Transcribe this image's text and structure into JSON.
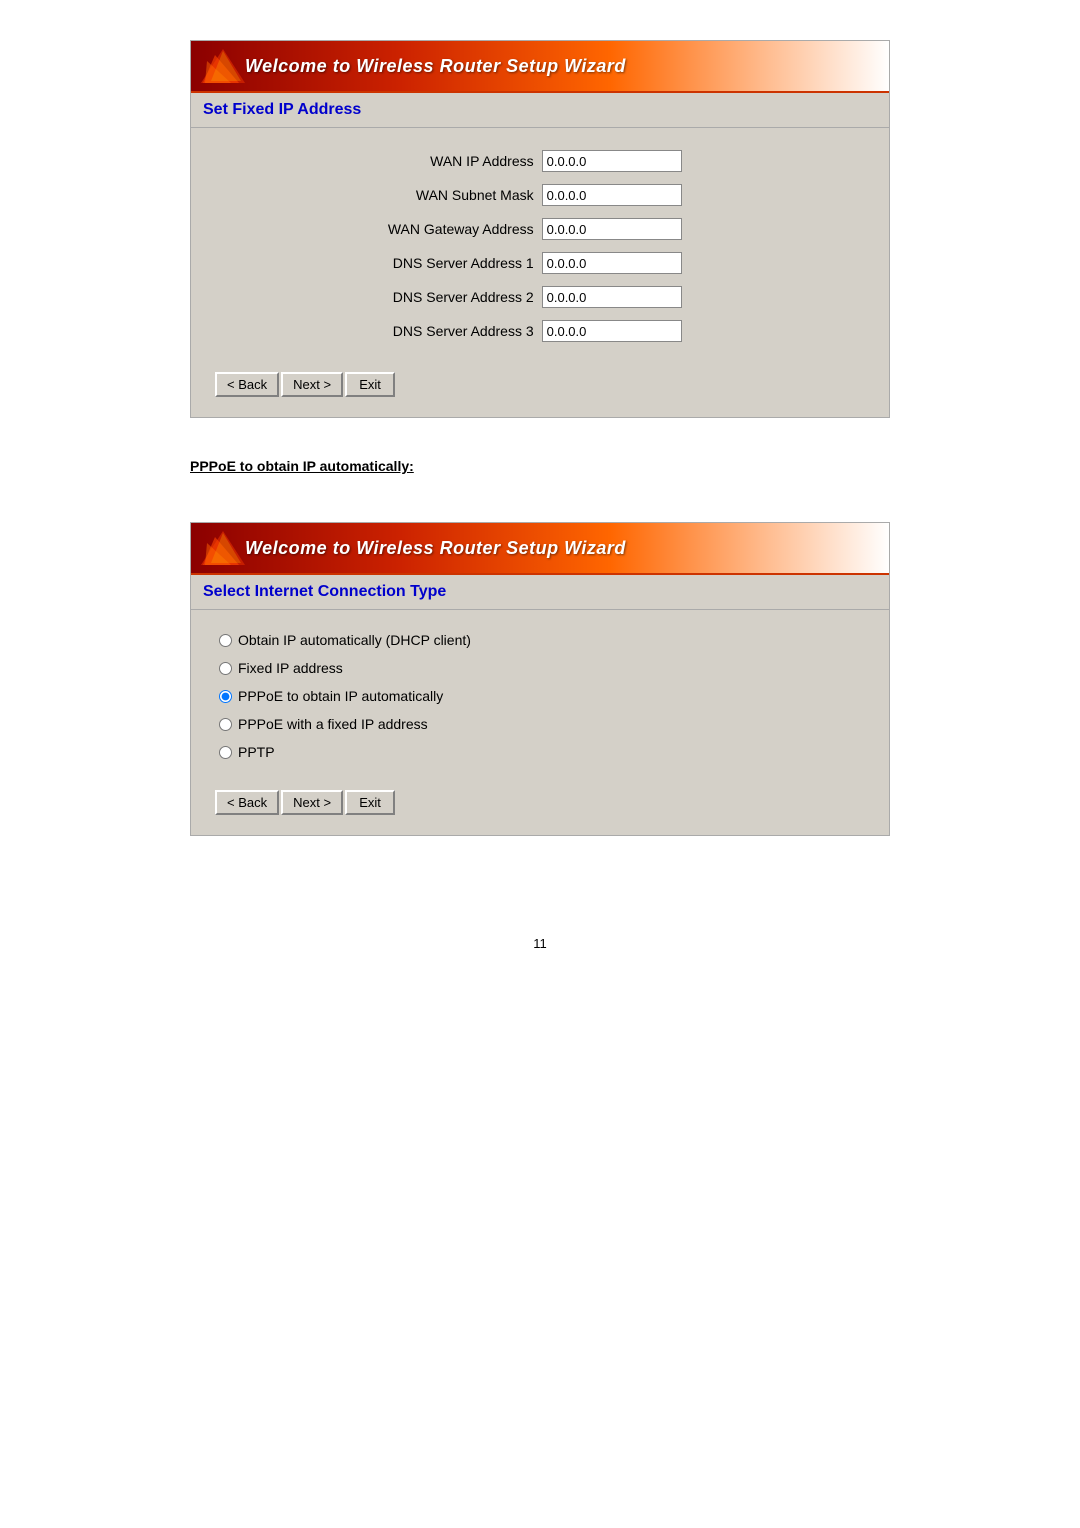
{
  "page": {
    "number": "11"
  },
  "panel1": {
    "header_title": "Welcome to Wireless Router Setup Wizard",
    "section_title": "Set Fixed IP Address",
    "fields": [
      {
        "label": "WAN IP Address",
        "value": "0.0.0.0"
      },
      {
        "label": "WAN Subnet Mask",
        "value": "0.0.0.0"
      },
      {
        "label": "WAN Gateway Address",
        "value": "0.0.0.0"
      },
      {
        "label": "DNS Server Address 1",
        "value": "0.0.0.0"
      },
      {
        "label": "DNS Server Address 2",
        "value": "0.0.0.0"
      },
      {
        "label": "DNS Server Address 3",
        "value": "0.0.0.0"
      }
    ],
    "buttons": {
      "back": "< Back",
      "next": "Next >",
      "exit": "Exit"
    }
  },
  "section2_label": "PPPoE to obtain IP automatically:",
  "panel2": {
    "header_title": "Welcome to Wireless Router Setup Wizard",
    "section_title": "Select Internet Connection Type",
    "options": [
      {
        "id": "opt1",
        "label": "Obtain IP automatically (DHCP client)",
        "selected": false
      },
      {
        "id": "opt2",
        "label": "Fixed IP address",
        "selected": false
      },
      {
        "id": "opt3",
        "label": "PPPoE to obtain IP automatically",
        "selected": true
      },
      {
        "id": "opt4",
        "label": "PPPoE with a fixed IP address",
        "selected": false
      },
      {
        "id": "opt5",
        "label": "PPTP",
        "selected": false
      }
    ],
    "buttons": {
      "back": "< Back",
      "next": "Next >",
      "exit": "Exit"
    }
  }
}
